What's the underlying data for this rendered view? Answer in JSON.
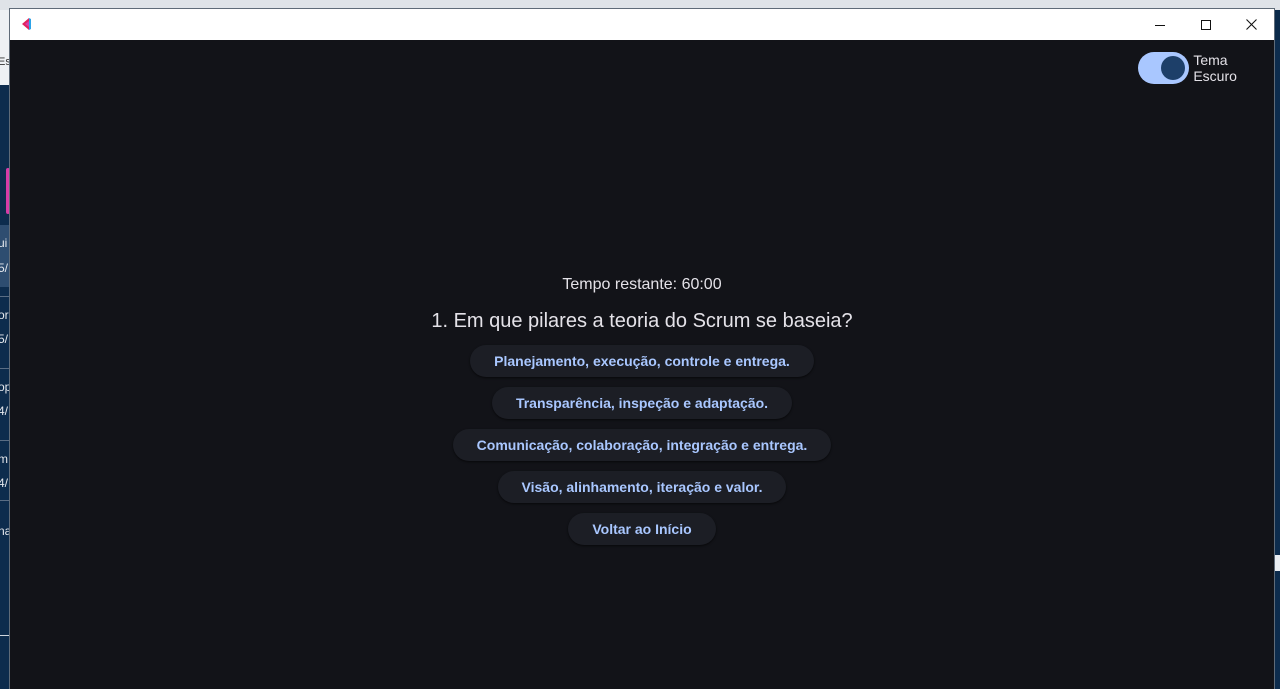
{
  "window": {
    "title": "",
    "minimize_label": "Minimize",
    "maximize_label": "Maximize",
    "close_label": "Close"
  },
  "theme_toggle": {
    "label": "Tema Escuro",
    "enabled": true
  },
  "quiz": {
    "timer": "Tempo restante: 60:00",
    "question": "1. Em que pilares a teoria do Scrum se baseia?",
    "options": [
      "Planejamento, execução, controle e entrega.",
      "Transparência, inspeção e adaptação.",
      "Comunicação, colaboração, integração e entrega.",
      "Visão, alinhamento, iteração e valor."
    ],
    "back_button": "Voltar ao Início"
  },
  "background_fragments": [
    "Es",
    "ui",
    "5/",
    "or",
    "5/",
    "op",
    "4/",
    "m",
    "4/",
    "na"
  ],
  "colors": {
    "app_background": "#121318",
    "accent": "#a9c7ff",
    "button_surface": "#1c1e25",
    "text": "#e4e2e8",
    "app_icon_red": "#e0245e",
    "app_icon_pink": "#d63ca8"
  },
  "icons": {
    "app": "app-logo-icon",
    "minimize": "minimize-icon",
    "maximize": "maximize-icon",
    "close": "close-icon"
  }
}
